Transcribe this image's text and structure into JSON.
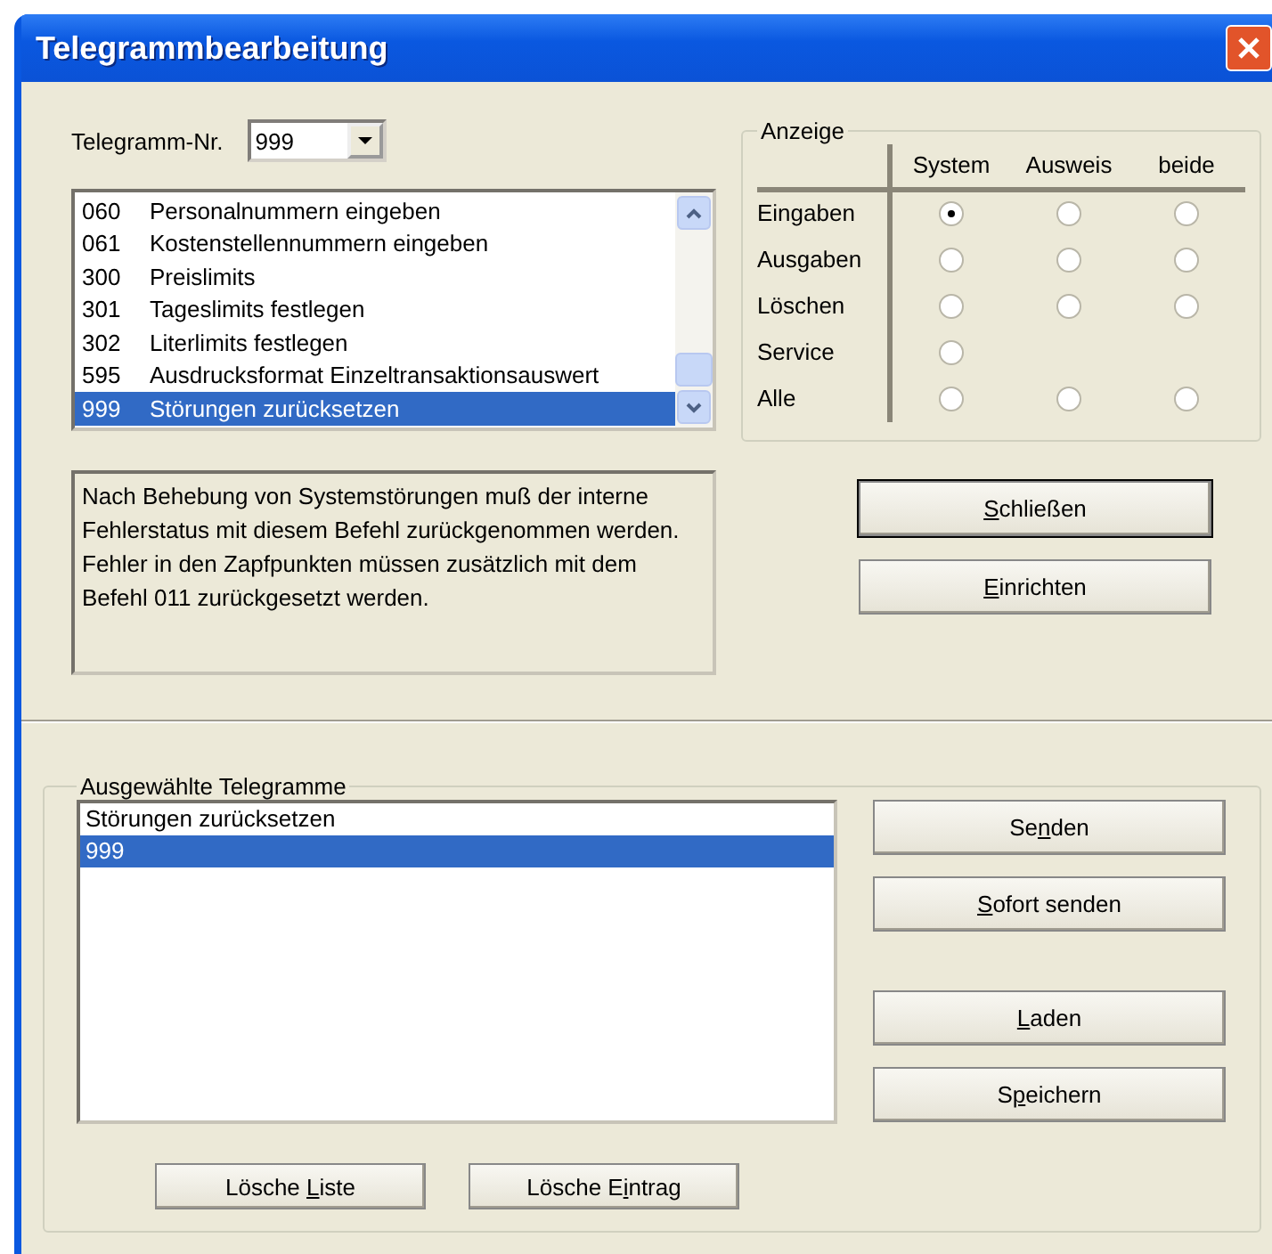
{
  "window": {
    "title": "Telegrammbearbeitung"
  },
  "telegram_no": {
    "label": "Telegramm-Nr.",
    "value": "999"
  },
  "telegram_list": [
    {
      "code": "060",
      "name": "Personalnummern eingeben",
      "selected": false
    },
    {
      "code": "061",
      "name": "Kostenstellennummern eingeben",
      "selected": false
    },
    {
      "code": "300",
      "name": "Preislimits",
      "selected": false
    },
    {
      "code": "301",
      "name": "Tageslimits festlegen",
      "selected": false
    },
    {
      "code": "302",
      "name": "Literlimits festlegen",
      "selected": false
    },
    {
      "code": "595",
      "name": "Ausdrucksformat Einzeltransaktionsauswert",
      "selected": false
    },
    {
      "code": "999",
      "name": "Störungen zurücksetzen",
      "selected": true
    }
  ],
  "description": "Nach Behebung von Systemstörungen muß der interne Fehlerstatus mit diesem Befehl zurückgenommen werden. Fehler in den Zapfpunkten müssen zusätzlich mit dem Befehl 011 zurückgesetzt werden.",
  "anzeige": {
    "title": "Anzeige",
    "columns": [
      "System",
      "Ausweis",
      "beide"
    ],
    "rows": [
      {
        "label": "Eingaben",
        "options": [
          {
            "selected": true
          },
          {
            "selected": false
          },
          {
            "selected": false
          }
        ]
      },
      {
        "label": "Ausgaben",
        "options": [
          {
            "selected": false
          },
          {
            "selected": false
          },
          {
            "selected": false
          }
        ]
      },
      {
        "label": "Löschen",
        "options": [
          {
            "selected": false
          },
          {
            "selected": false
          },
          {
            "selected": false
          }
        ]
      },
      {
        "label": "Service",
        "options": [
          {
            "selected": false
          }
        ]
      },
      {
        "label": "Alle",
        "options": [
          {
            "selected": false
          },
          {
            "selected": false
          },
          {
            "selected": false
          }
        ]
      }
    ]
  },
  "top_buttons": [
    {
      "key": "S",
      "after": "chließen",
      "default": true
    },
    {
      "key": "E",
      "after": "inrichten",
      "default": false
    }
  ],
  "selected_group": {
    "title": "Ausgewählte Telegramme",
    "items": [
      {
        "text": "Störungen zurücksetzen",
        "selected": false
      },
      {
        "text": "999",
        "selected": true
      }
    ],
    "buttons": [
      {
        "before": "Lösche ",
        "key": "L",
        "after": "iste"
      },
      {
        "before": "Lösche E",
        "key": "i",
        "after": "ntrag"
      }
    ]
  },
  "side_button_groups": [
    [
      {
        "before": "Se",
        "key": "n",
        "after": "den"
      },
      {
        "key": "S",
        "after": "ofort senden"
      }
    ],
    [
      {
        "key": "L",
        "after": "aden"
      },
      {
        "before": "S",
        "key": "p",
        "after": "eichern"
      }
    ]
  ]
}
